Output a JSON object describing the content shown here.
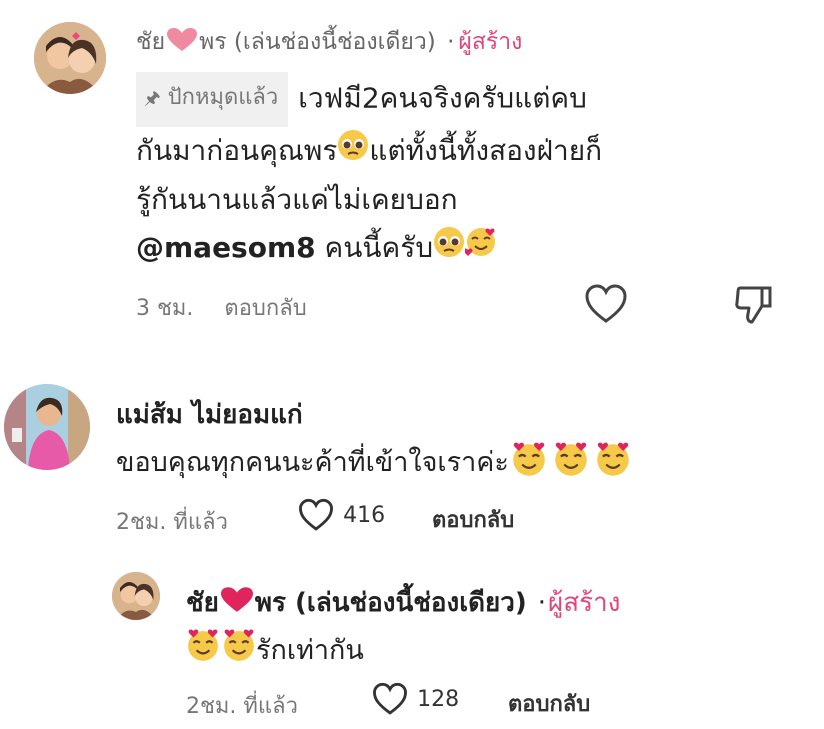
{
  "comment1": {
    "author_prefix": "ชัย",
    "author_suffix": "พร (เล่นช่องนี้ช่องเดียว)",
    "dot": "·",
    "creator_label": "ผู้สร้าง",
    "pinned_label": "ปักหมุดแล้ว",
    "line1": "เวฟมี2คนจริงครับแต่คบ",
    "line2a": "กันมาก่อนคุณพร",
    "line2b": "แต่ทั้งนี้ทั้งสองฝ่ายก็",
    "line3": "รู้กันนานแล้วแค่ไม่เคยบอก",
    "mention": "@maesom8",
    "line4": "คนนี้ครับ",
    "time": "3 ชม.",
    "reply_label": "ตอบกลับ"
  },
  "comment2": {
    "author": "แม่ส้ม ไม่ยอมแก่",
    "text": "ขอบคุณทุกคนนะค้าที่เข้าใจเราค่ะ",
    "time": "2ชม. ที่แล้ว",
    "likes": "416",
    "reply_label": "ตอบกลับ"
  },
  "reply1": {
    "author_prefix": "ชัย",
    "author_suffix": "พร (เล่นช่องนี้ช่องเดียว)",
    "dot": "·",
    "creator_label": "ผู้สร้าง",
    "text": "รักเท่ากัน",
    "time": "2ชม. ที่แล้ว",
    "likes": "128",
    "reply_label": "ตอบกลับ"
  },
  "colors": {
    "creator": "#e0457a",
    "heart": "#e0245e",
    "meta": "#777777",
    "pin_bg": "#f0f0f0"
  },
  "icons": [
    "heart-icon",
    "dislike-icon",
    "pin-icon",
    "pleading-emoji",
    "smiling-hearts-emoji"
  ]
}
